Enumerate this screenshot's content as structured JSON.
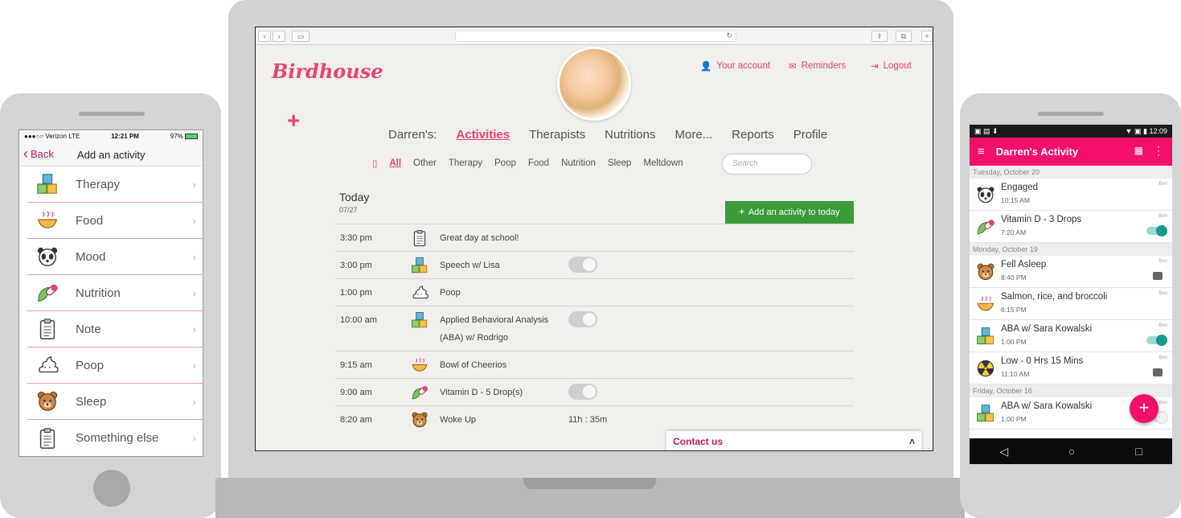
{
  "iphone": {
    "status": {
      "carrier": "●●●○○ Verizon  LTE",
      "time": "12:21 PM",
      "battery": "97%"
    },
    "nav": {
      "back": "Back",
      "title": "Add an activity"
    },
    "items": [
      {
        "label": "Therapy",
        "icon": "blocks-icon"
      },
      {
        "label": "Food",
        "icon": "bowl-icon"
      },
      {
        "label": "Mood",
        "icon": "panda-icon"
      },
      {
        "label": "Nutrition",
        "icon": "pill-leaf-icon"
      },
      {
        "label": "Note",
        "icon": "clipboard-icon"
      },
      {
        "label": "Poop",
        "icon": "poop-icon"
      },
      {
        "label": "Sleep",
        "icon": "bear-icon"
      },
      {
        "label": "Something else",
        "icon": "clipboard-icon"
      }
    ]
  },
  "web": {
    "logo": "Birdhouse",
    "links": {
      "account": "Your account",
      "reminders": "Reminders",
      "logout": "Logout"
    },
    "tabs": {
      "owner": "Darren's:",
      "activities": "Activities",
      "therapists": "Therapists",
      "nutritions": "Nutritions",
      "more": "More...",
      "reports": "Reports",
      "profile": "Profile"
    },
    "filters": {
      "all": "All",
      "other": "Other",
      "therapy": "Therapy",
      "poop": "Poop",
      "food": "Food",
      "nutrition": "Nutrition",
      "sleep": "Sleep",
      "meltdown": "Meltdown"
    },
    "search_placeholder": "Search",
    "today": "Today",
    "date": "07/27",
    "add_button": "Add an activity to today",
    "rows": [
      {
        "time": "3:30 pm",
        "text": "Great day at school!",
        "icon": "clipboard-icon"
      },
      {
        "time": "3:00 pm",
        "text": "Speech w/ Lisa",
        "icon": "blocks-icon",
        "toggle": "off"
      },
      {
        "time": "1:00 pm",
        "text": "Poop",
        "icon": "poop-icon"
      },
      {
        "time": "10:00 am",
        "text": "Applied Behavioral Analysis (ABA) w/ Rodrigo",
        "icon": "blocks-icon",
        "toggle": "off"
      },
      {
        "time": "9:15 am",
        "text": "Bowl of Cheerios",
        "icon": "bowl-icon"
      },
      {
        "time": "9:00 am",
        "text": "Vitamin D - 5 Drop(s)",
        "icon": "pill-leaf-icon",
        "toggle": "off"
      },
      {
        "time": "8:20 am",
        "text": "Woke Up",
        "icon": "bear-icon",
        "duration": "11h : 35m"
      }
    ],
    "contact": "Contact us"
  },
  "android": {
    "status_time": "12:09",
    "title": "Darren's Activity",
    "sections": [
      {
        "day": "Tuesday, October 20",
        "items": [
          {
            "title": "Engaged",
            "time": "10:15 AM",
            "icon": "panda-icon",
            "by": "Ben"
          },
          {
            "title": "Vitamin D - 3 Drops",
            "time": "7:20 AM",
            "icon": "pill-leaf-icon",
            "by": "Ben",
            "toggle": "on"
          }
        ]
      },
      {
        "day": "Monday, October 19",
        "items": [
          {
            "title": "Fell Asleep",
            "time": "8:40 PM",
            "icon": "bear-icon",
            "by": "Ben",
            "comment": true
          },
          {
            "title": "Salmon, rice, and broccoli",
            "time": "6:15 PM",
            "icon": "bowl-icon",
            "by": "Ben"
          },
          {
            "title": "ABA w/ Sara Kowalski",
            "time": "1:00 PM",
            "icon": "blocks-icon",
            "by": "Ben",
            "toggle": "on"
          },
          {
            "title": "Low - 0 Hrs 15 Mins",
            "time": "11:10 AM",
            "icon": "meltdown-icon",
            "by": "Ben",
            "comment": true
          }
        ]
      },
      {
        "day": "Friday, October 16",
        "items": [
          {
            "title": "ABA w/ Sara Kowalski",
            "time": "1:00 PM",
            "icon": "blocks-icon",
            "by": "Ben",
            "toggle": "off"
          }
        ]
      }
    ]
  }
}
